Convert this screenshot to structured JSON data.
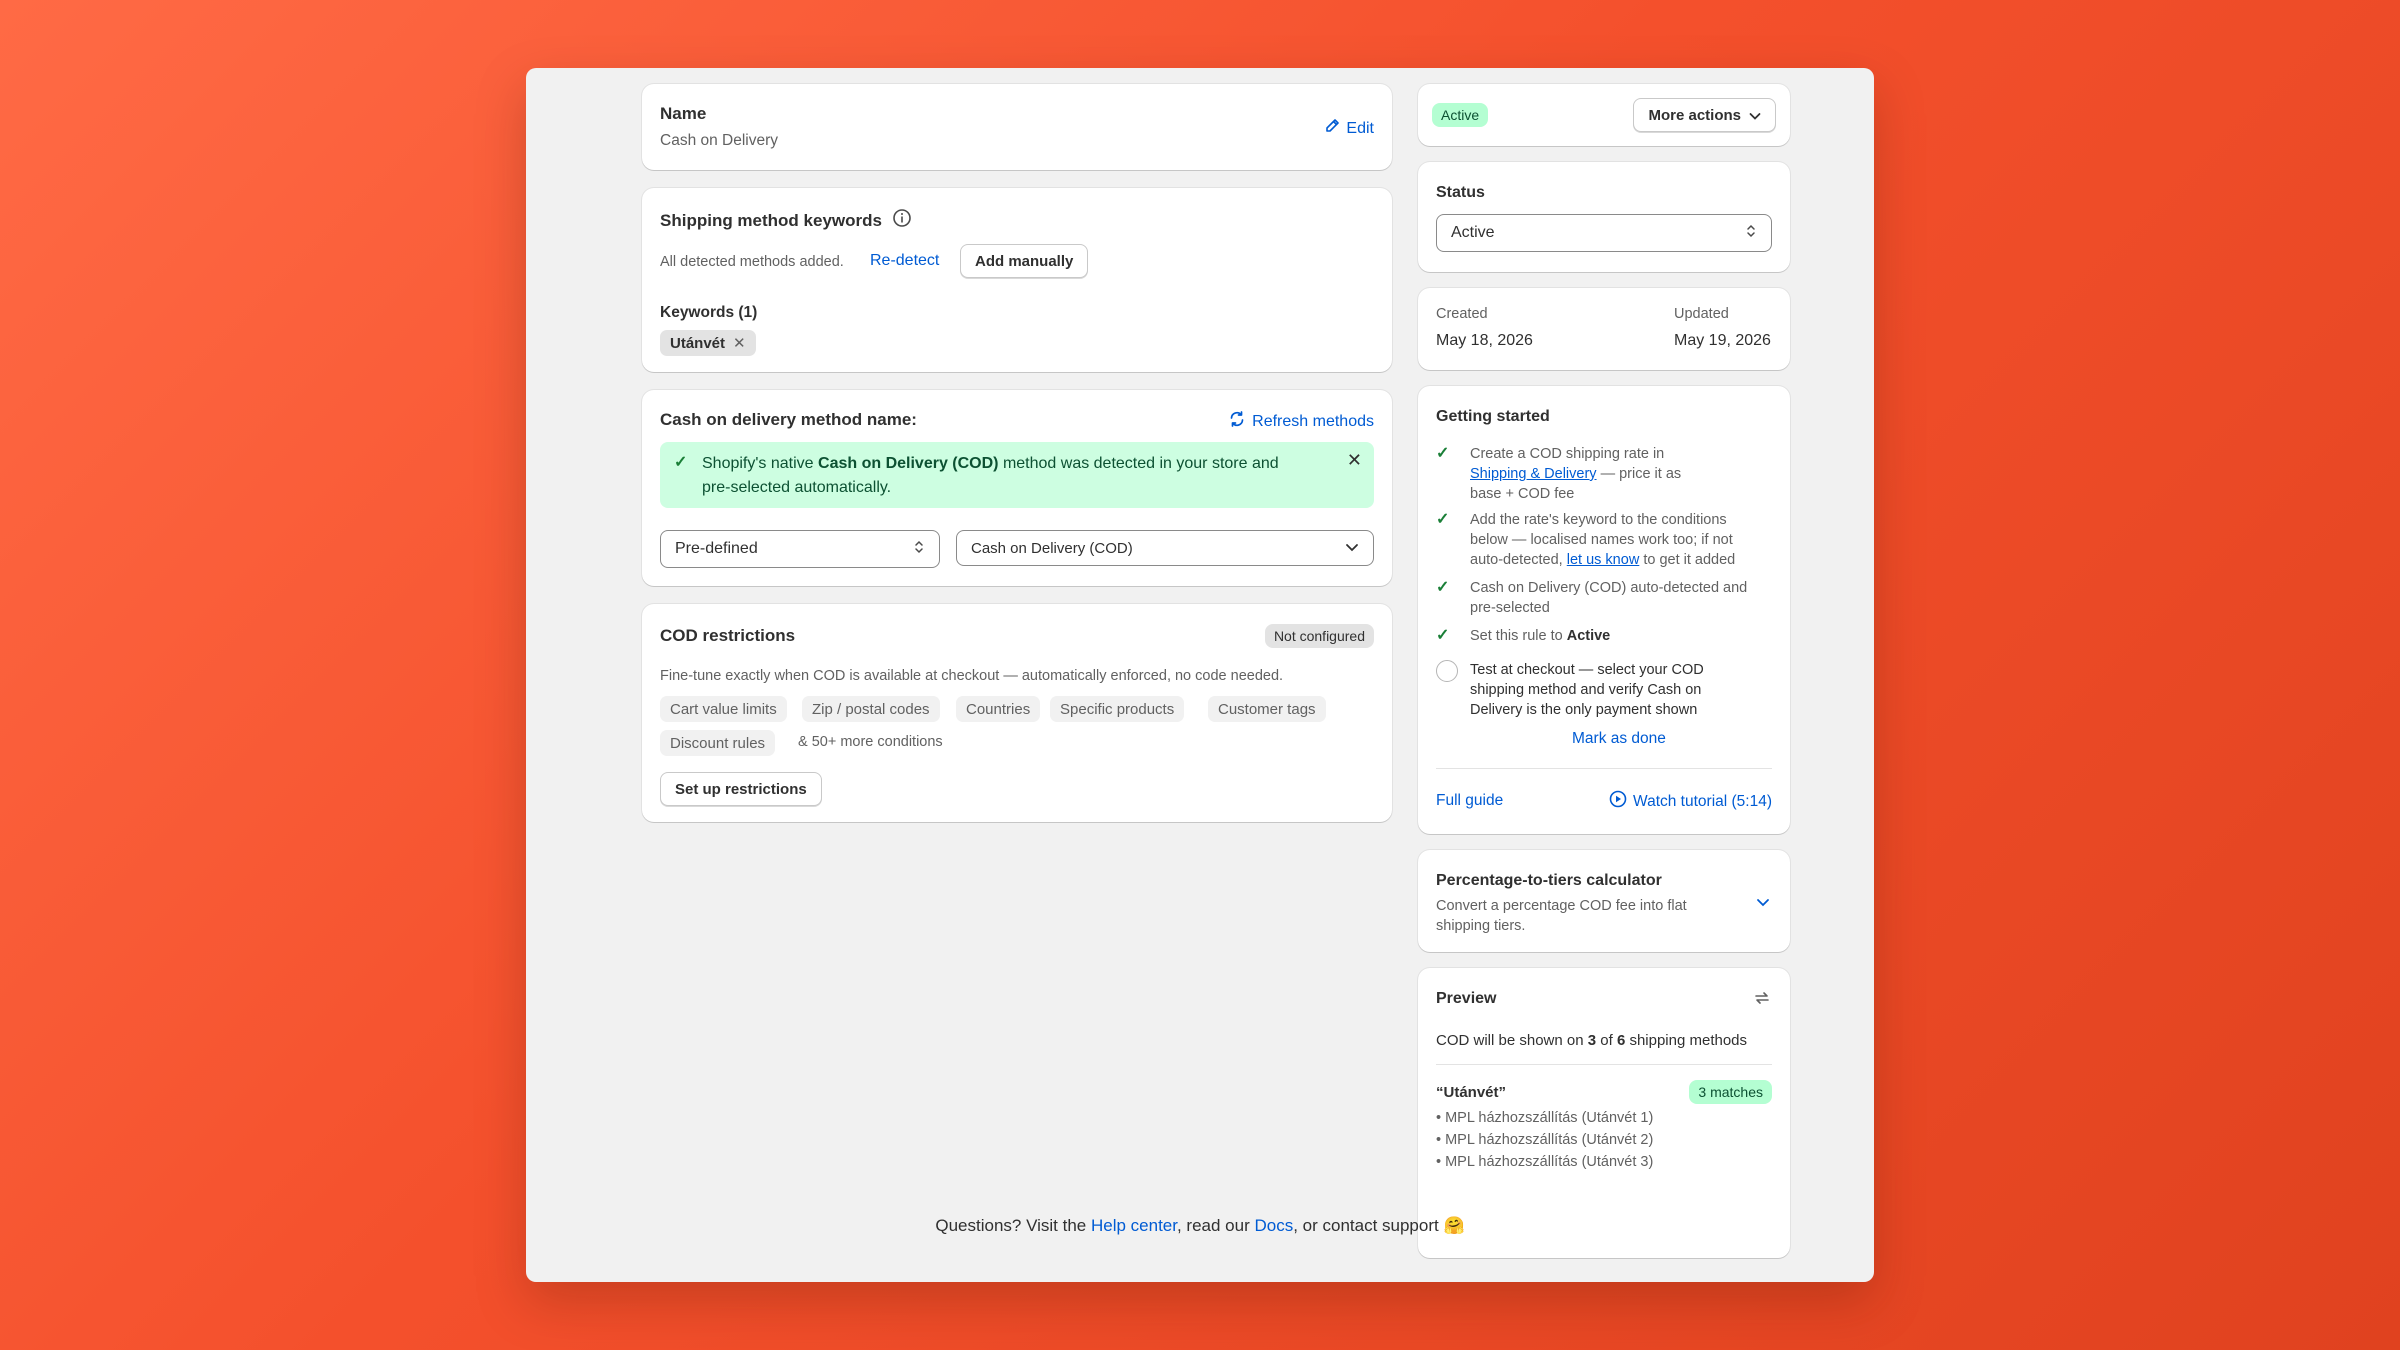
{
  "name_card": {
    "label": "Name",
    "value": "Cash on Delivery",
    "edit_label": "Edit"
  },
  "keywords_card": {
    "title": "Shipping method keywords",
    "detected_text": "All detected methods added.",
    "redetect_label": "Re-detect",
    "add_manually_label": "Add manually",
    "keywords_label": "Keywords (1)",
    "keyword_tag": "Utánvét"
  },
  "cod_method_card": {
    "title": "Cash on delivery method name:",
    "refresh_label": "Refresh methods",
    "banner_pre": "Shopify's native ",
    "banner_bold": "Cash on Delivery (COD)",
    "banner_post": " method was detected in your store and",
    "banner_line2": "pre-selected automatically.",
    "type_select": "Pre-defined",
    "method_select": "Cash on Delivery (COD)"
  },
  "restrictions_card": {
    "title": "COD restrictions",
    "status_badge": "Not configured",
    "description": "Fine-tune exactly when COD is available at checkout — automatically enforced, no code needed.",
    "chips": [
      "Cart value limits",
      "Zip / postal codes",
      "Countries",
      "Specific products",
      "Customer tags",
      "Discount rules"
    ],
    "more_text": "& 50+ more conditions",
    "setup_label": "Set up restrictions"
  },
  "header_card": {
    "status_badge": "Active",
    "more_actions_label": "More actions"
  },
  "status_card": {
    "label": "Status",
    "value": "Active"
  },
  "dates_card": {
    "created_label": "Created",
    "created_value": "May 18, 2026",
    "updated_label": "Updated",
    "updated_value": "May 19, 2026"
  },
  "getting_started": {
    "title": "Getting started",
    "item1_l1": "Create a COD shipping rate in",
    "item1_link": "Shipping & Delivery",
    "item1_l2_post": " — price it as",
    "item1_l3": "base + COD fee",
    "item2_l1": "Add the rate's keyword to the conditions",
    "item2_l2": "below — localised names work too; if not",
    "item2_l3_pre": "auto-detected, ",
    "item2_link": "let us know",
    "item2_l3_post": " to get it added",
    "item3_l1": "Cash on Delivery (COD) auto-detected and",
    "item3_l2": "pre-selected",
    "item4_pre": "Set this rule to ",
    "item4_bold": "Active",
    "item5_l1": "Test at checkout — select your COD",
    "item5_l2": "shipping method and verify Cash on",
    "item5_l3": "Delivery is the only payment shown",
    "mark_done_label": "Mark as done",
    "full_guide_label": "Full guide",
    "watch_label": "Watch tutorial (5:14)"
  },
  "calculator_card": {
    "title": "Percentage-to-tiers calculator",
    "desc_l1": "Convert a percentage COD fee into flat",
    "desc_l2": "shipping tiers."
  },
  "preview_card": {
    "title": "Preview",
    "summary_pre": "COD will be shown on ",
    "summary_shown": "3",
    "summary_mid": " of ",
    "summary_total": "6",
    "summary_post": " shipping methods",
    "keyword": "“Utánvét”",
    "matches_badge": "3 matches",
    "items": [
      "• MPL házhozszállítás (Utánvét 1)",
      "• MPL házhozszállítás (Utánvét 2)",
      "• MPL házhozszállítás (Utánvét 3)"
    ]
  },
  "footer": {
    "pre": "Questions? Visit the ",
    "help": "Help center",
    "mid": ", read our ",
    "docs": "Docs",
    "post": ", or contact support ",
    "emoji": "🤗"
  },
  "colors": {
    "accent_link": "#005bd3",
    "success_bg": "#cdfee1",
    "background_orange": "#f4502c"
  }
}
